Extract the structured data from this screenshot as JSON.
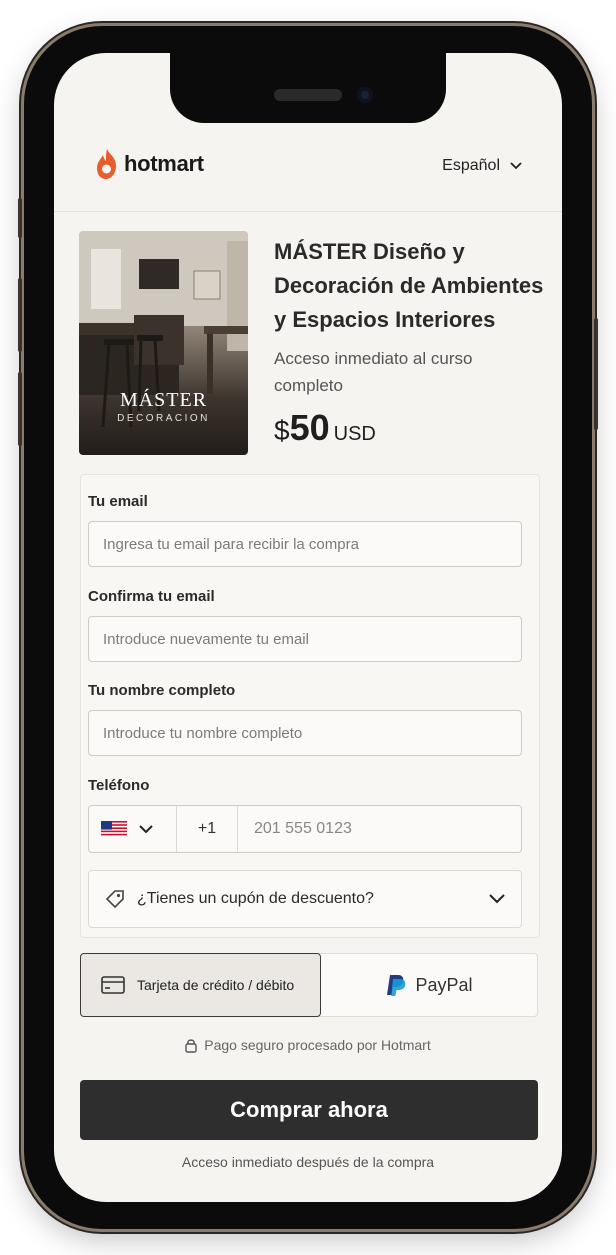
{
  "header": {
    "logo_text": "hotmart",
    "language": "Español"
  },
  "product": {
    "thumbnail_title": "MÁSTER",
    "thumbnail_subtitle": "DECORACION",
    "title": "MÁSTER Diseño y Decoración de Ambientes y Espacios Interiores",
    "subtitle": "Acceso inmediato al curso completo",
    "price_currency_symbol": "$",
    "price_amount": "50",
    "price_currency_code": "USD"
  },
  "form": {
    "email_label": "Tu email",
    "email_placeholder": "Ingresa tu email para recibir la compra",
    "confirm_label": "Confirma tu email",
    "confirm_placeholder": "Introduce nuevamente tu email",
    "name_label": "Tu nombre completo",
    "name_placeholder": "Introduce tu nombre completo",
    "phone_label": "Teléfono",
    "phone_country_flag": "us-flag",
    "phone_dial_code": "+1",
    "phone_placeholder": "201 555 0123",
    "coupon_label": "¿Tienes un cupón de descuento?"
  },
  "payment": {
    "card_label": "Tarjeta de crédito / débito",
    "paypal_label": "PayPal",
    "secure_text": "Pago seguro procesado por Hotmart"
  },
  "cta": {
    "buy_label": "Comprar ahora",
    "note": "Acceso inmediato después de la compra"
  },
  "colors": {
    "accent": "#e85d2c",
    "button": "#2e2e2e",
    "background": "#f6f4f0",
    "paypal_dark": "#253b80",
    "paypal_light": "#179bd7"
  }
}
